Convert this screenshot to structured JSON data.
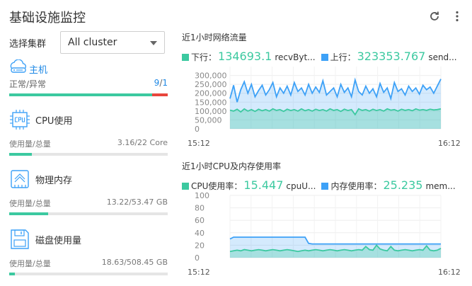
{
  "page": {
    "title": "基础设施监控",
    "refresh_icon": "refresh-icon",
    "more_icon": "more-vertical-icon"
  },
  "cluster": {
    "label": "选择集群",
    "selected": "All cluster"
  },
  "host": {
    "label": "主机",
    "icon": "cloud-server-icon",
    "status_label": "正常/异常",
    "normal": "9",
    "separator": "/",
    "abnormal": "1",
    "normal_fraction": 0.9
  },
  "metrics": [
    {
      "icon": "cpu-icon",
      "title": "CPU使用",
      "usage_label": "使用量/总量",
      "value": "3.16/22 Core",
      "fraction": 0.144
    },
    {
      "icon": "memory-icon",
      "title": "物理内存",
      "usage_label": "使用量/总量",
      "value": "13.22/53.47 GB",
      "fraction": 0.247
    },
    {
      "icon": "disk-icon",
      "title": "磁盘使用量",
      "usage_label": "使用量/总量",
      "value": "18.63/508.45 GB",
      "fraction": 0.037
    }
  ],
  "colors": {
    "green": "#3cc9a0",
    "blue": "#3da1f7",
    "red": "#e8463d",
    "accent": "#1e88e5"
  },
  "network": {
    "title": "近1小时网络流量",
    "legend": [
      {
        "label": "下行：",
        "value": "134693.1",
        "key": "recvByt...",
        "color": "#3cc9a0"
      },
      {
        "label": "上行：",
        "value": "323353.767",
        "key": "send...",
        "color": "#3da1f7"
      }
    ]
  },
  "usage": {
    "title": "近1小时CPU及内存使用率",
    "legend": [
      {
        "label": "CPU使用率：",
        "value": "15.447",
        "key": "cpuU...",
        "color": "#3cc9a0"
      },
      {
        "label": "内存使用率：",
        "value": "25.235",
        "key": "mem...",
        "color": "#3da1f7"
      }
    ]
  },
  "chart_data": [
    {
      "type": "area",
      "title": "近1小时网络流量",
      "x_ticks": [
        "15:12",
        "16:12"
      ],
      "y_ticks": [
        "300,000",
        "250,000",
        "200,000",
        "150,000",
        "100,000",
        "50,000",
        "0"
      ],
      "ylim": [
        0,
        350000
      ],
      "grid": true,
      "series": [
        {
          "name": "下行",
          "color": "#3cc9a0",
          "values": [
            105000,
            100000,
            110000,
            95000,
            112000,
            100000,
            108000,
            98000,
            110000,
            102000,
            108000,
            100000,
            112000,
            104000,
            108000,
            98000,
            110000,
            103000,
            108000,
            100000,
            112000,
            102000,
            108000,
            100000,
            110000,
            103000,
            108000,
            100000,
            112000,
            104000,
            108000,
            98000,
            110000,
            103000,
            108000,
            80000,
            112000,
            104000,
            108000,
            100000,
            110000,
            103000,
            108000,
            100000,
            112000,
            105000,
            108000,
            100000,
            110000,
            104000,
            108000,
            102000,
            112000,
            105000,
            108000,
            104000,
            110000,
            106000,
            108000,
            112000
          ]
        },
        {
          "name": "上行",
          "color": "#3da1f7",
          "values": [
            170000,
            245000,
            150000,
            220000,
            265000,
            200000,
            250000,
            180000,
            215000,
            245000,
            190000,
            220000,
            260000,
            180000,
            230000,
            200000,
            240000,
            190000,
            260000,
            210000,
            230000,
            190000,
            250000,
            200000,
            235000,
            205000,
            270000,
            190000,
            210000,
            230000,
            180000,
            250000,
            205000,
            230000,
            180000,
            275000,
            210000,
            190000,
            240000,
            200000,
            225000,
            180000,
            255000,
            205000,
            230000,
            170000,
            260000,
            210000,
            225000,
            190000,
            240000,
            210000,
            230000,
            195000,
            245000,
            220000,
            235000,
            200000,
            240000,
            280000
          ]
        }
      ]
    },
    {
      "type": "area",
      "title": "近1小时CPU及内存使用率",
      "x_ticks": [
        "15:12",
        "16:12"
      ],
      "y_ticks": [
        "100",
        "80",
        "60",
        "40",
        "20",
        "0"
      ],
      "ylim": [
        0,
        100
      ],
      "grid": true,
      "series": [
        {
          "name": "CPU使用率",
          "color": "#3cc9a0",
          "values": [
            10,
            11,
            12,
            11,
            13,
            12,
            11,
            12,
            13,
            12,
            11,
            12,
            13,
            12,
            11,
            12,
            13,
            12,
            11,
            10,
            11,
            12,
            11,
            12,
            13,
            12,
            11,
            12,
            13,
            12,
            11,
            12,
            13,
            12,
            11,
            12,
            13,
            12,
            18,
            13,
            12,
            20,
            14,
            12,
            11,
            18,
            12,
            11,
            12,
            13,
            12,
            11,
            12,
            13,
            12,
            19,
            12,
            11,
            12,
            15
          ]
        },
        {
          "name": "内存使用率",
          "color": "#3da1f7",
          "values": [
            30,
            33,
            33,
            33,
            33,
            33,
            33,
            33,
            33,
            33,
            33,
            33,
            33,
            33,
            33,
            33,
            33,
            33,
            33,
            33,
            33,
            33,
            23,
            22,
            22,
            22,
            22,
            22,
            22,
            22,
            22,
            22,
            22,
            22,
            22,
            22,
            22,
            22,
            22,
            22,
            22,
            22,
            22,
            22,
            22,
            22,
            22,
            22,
            22,
            22,
            22,
            22,
            22,
            22,
            22,
            22,
            22,
            22,
            22,
            22
          ]
        }
      ]
    }
  ]
}
